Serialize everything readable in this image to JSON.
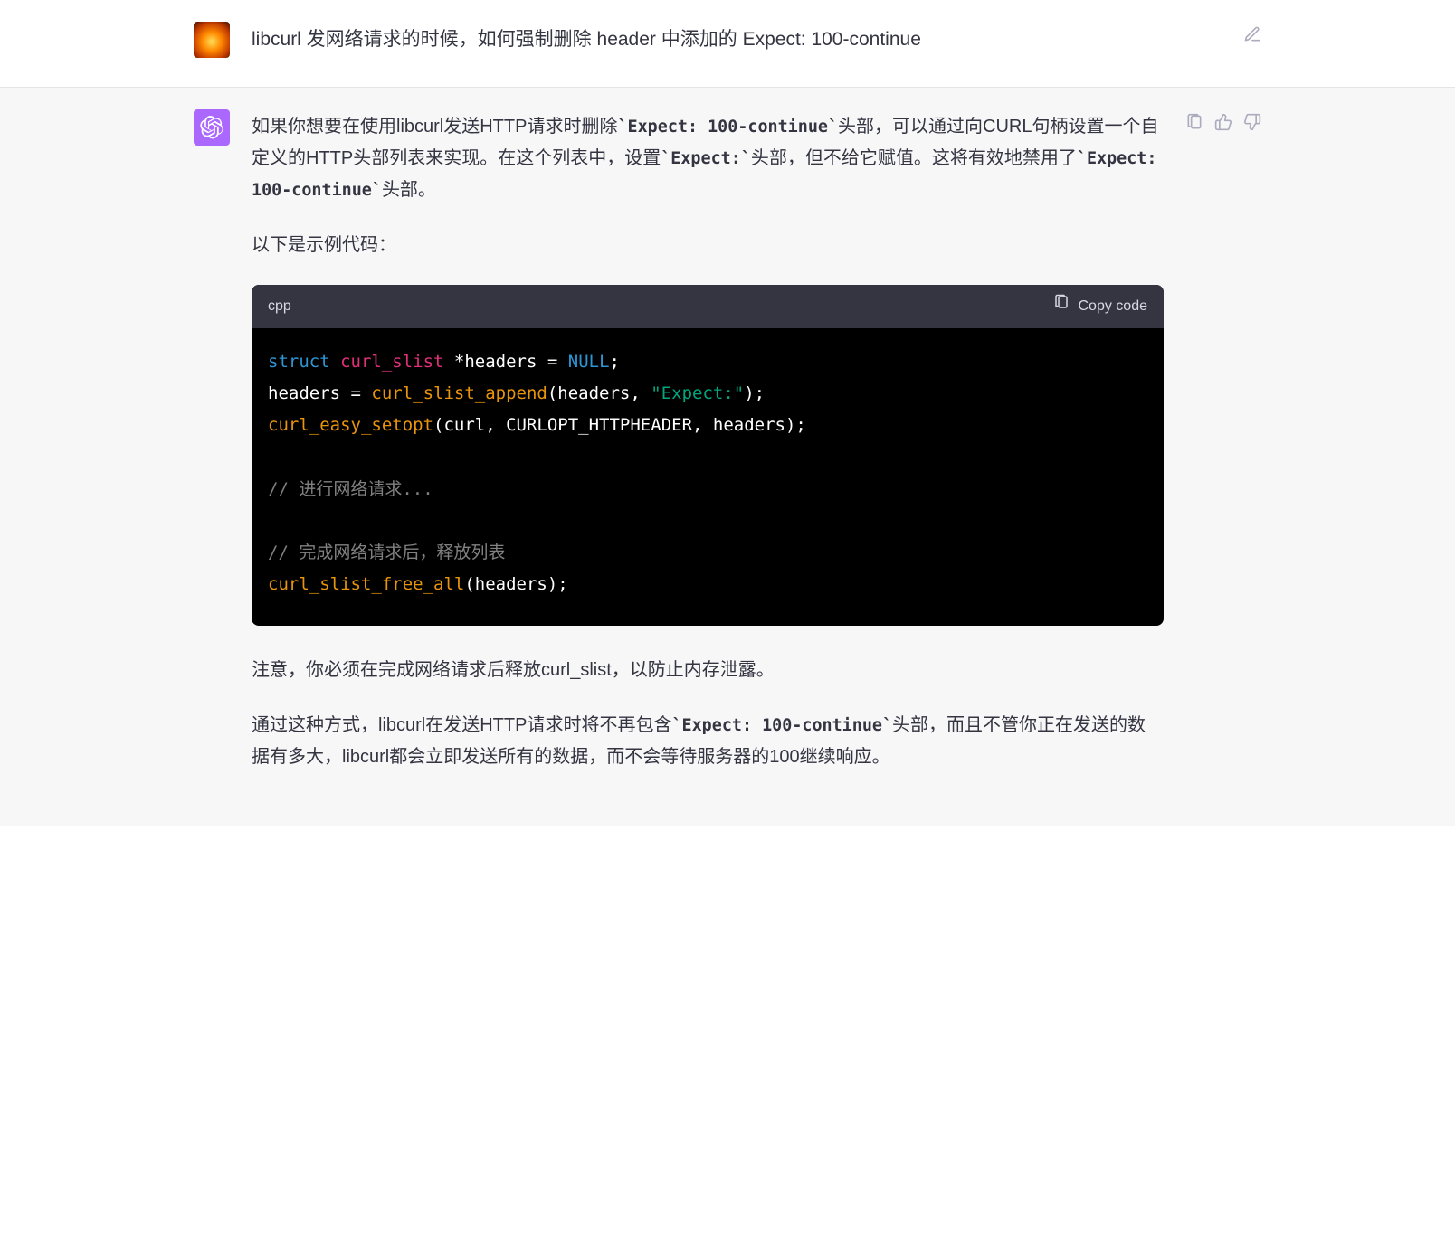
{
  "user_message": {
    "text": "libcurl 发网络请求的时候，如何强制删除 header 中添加的 Expect: 100-continue"
  },
  "assistant_message": {
    "para1": {
      "seg1": "如果你想要在使用libcurl发送HTTP请求时删除",
      "code1": "`Expect: 100-continue`",
      "seg2": "头部，可以通过向CURL句柄设置一个自定义的HTTP头部列表来实现。在这个列表中，设置",
      "code2": "`Expect:`",
      "seg3": "头部，但不给它赋值。这将有效地禁用了",
      "code3": "`Expect: 100-continue`",
      "seg4": "头部。"
    },
    "para2": "以下是示例代码：",
    "code_block": {
      "language": "cpp",
      "copy_label": "Copy code",
      "lines": {
        "l1": {
          "kw": "struct",
          "type": "curl_slist",
          "rest": " *headers = ",
          "null": "NULL",
          "end": ";"
        },
        "l2": {
          "pre": "headers = ",
          "func": "curl_slist_append",
          "mid": "(headers, ",
          "str": "\"Expect:\"",
          "end": ");"
        },
        "l3": {
          "func": "curl_easy_setopt",
          "rest": "(curl, CURLOPT_HTTPHEADER, headers);"
        },
        "l4": "",
        "l5": {
          "com": "// 进行网络请求..."
        },
        "l6": "",
        "l7": {
          "com": "// 完成网络请求后，释放列表"
        },
        "l8": {
          "func": "curl_slist_free_all",
          "rest": "(headers);"
        }
      }
    },
    "para3": "注意，你必须在完成网络请求后释放curl_slist，以防止内存泄露。",
    "para4": {
      "seg1": "通过这种方式，libcurl在发送HTTP请求时将不再包含",
      "code1": "`Expect: 100-continue`",
      "seg2": "头部，而且不管你正在发送的数据有多大，libcurl都会立即发送所有的数据，而不会等待服务器的100继续响应。"
    }
  },
  "icons": {
    "edit": "edit-icon",
    "clipboard": "clipboard-icon",
    "thumbs_up": "thumbs-up-icon",
    "thumbs_down": "thumbs-down-icon"
  }
}
